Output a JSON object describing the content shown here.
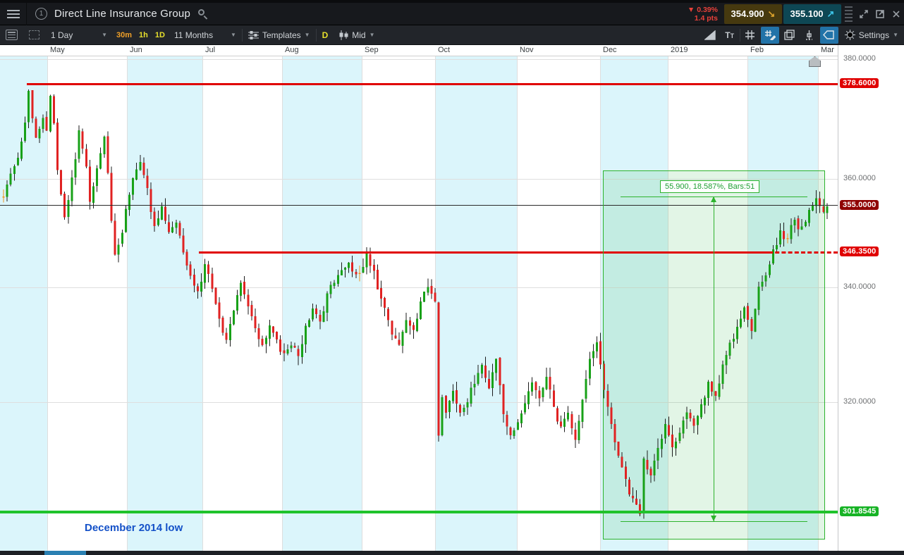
{
  "window": {
    "title": "Direct Line Insurance Group",
    "change_pct": "▼ 0.39%",
    "change_pts": "1.4 pts",
    "sell_price": "354.900",
    "buy_price": "355.100",
    "sell_arrow": "↘",
    "buy_arrow": "↗"
  },
  "toolbar": {
    "period": "1 Day",
    "intervals": [
      "30m",
      "1h",
      "1D"
    ],
    "range": "11 Months",
    "templates_label": "Templates",
    "chart_type_letter": "D",
    "price_mode": "Mid",
    "settings_label": "Settings",
    "accent_active": "#2273a8"
  },
  "chart_data": {
    "type": "candlestick",
    "instrument": "Direct Line Insurance Group",
    "period": "1 Day",
    "range": "11 Months",
    "month_labels": [
      "May",
      "Jun",
      "Jul",
      "Aug",
      "Sep",
      "Oct",
      "Nov",
      "Dec",
      "2019",
      "Feb",
      "Mar"
    ],
    "month_bounds": [
      0,
      67,
      180,
      287,
      400,
      513,
      617,
      733,
      851,
      947,
      1060,
      1160,
      1188
    ],
    "y_ticks": [
      {
        "price": 380,
        "label": "380.0000",
        "y_page": 84
      },
      {
        "price": 360,
        "label": "360.0000"
      },
      {
        "price": 340,
        "label": "340.0000"
      },
      {
        "price": 320,
        "label": "320.0000"
      }
    ],
    "levels": [
      {
        "name": "resistance-378",
        "price": 378.6,
        "label": "378.6000",
        "color": "#e00000",
        "badge_bg": "#e00000",
        "thick": 3,
        "x_start": 38,
        "style": "solid"
      },
      {
        "name": "current-355",
        "price": 355.0,
        "label": "355.0000",
        "color": "#2a2a2a",
        "badge_bg": "#8f0000",
        "thick": 1,
        "x_start": 0,
        "style": "solid"
      },
      {
        "name": "support-346",
        "price": 346.35,
        "label": "346.3500",
        "color": "#e00000",
        "badge_bg": "#e00000",
        "thick": 3,
        "x_start": 282,
        "dash_from": 1090,
        "style": "solid-then-dashed"
      },
      {
        "name": "dec-2014-low",
        "price": 301.8545,
        "label": "301.8545",
        "color": "#1fc32b",
        "badge_bg": "#17b325",
        "thick": 4,
        "x_start": 0,
        "style": "solid"
      }
    ],
    "measurement": {
      "label": "55.900, 18.587%, Bars:51",
      "value_pts": 55.9,
      "value_pct": "18.587%",
      "bars": 51,
      "box": {
        "x1": 855,
        "y1": 242,
        "x2": 1170,
        "y2": 766
      },
      "inner": {
        "x1": 880,
        "x2": 1145,
        "y_top": 279,
        "y_bot": 740,
        "arrow_x": 1012
      },
      "label_box": {
        "x": 936,
        "y": 256
      }
    },
    "annotation": {
      "text": "December 2014 low",
      "x": 120,
      "y": 741
    },
    "scale": {
      "type": "log",
      "p_ref": 378.6,
      "y_ref": 119,
      "k": 2685
    },
    "bars": {
      "count": 230,
      "x0": 5,
      "dx": 5.1,
      "body_w": 3,
      "seed": 1337,
      "close_anchors": [
        [
          0,
          357
        ],
        [
          2,
          361
        ],
        [
          4,
          364
        ],
        [
          6,
          371
        ],
        [
          7,
          377.5
        ],
        [
          8,
          372
        ],
        [
          9,
          368
        ],
        [
          10,
          370
        ],
        [
          11,
          372
        ],
        [
          12,
          369
        ],
        [
          13,
          376.5
        ],
        [
          14,
          371
        ],
        [
          15,
          362
        ],
        [
          16,
          357
        ],
        [
          17,
          353
        ],
        [
          18,
          356
        ],
        [
          19,
          360
        ],
        [
          20,
          364
        ],
        [
          21,
          369
        ],
        [
          22,
          366
        ],
        [
          23,
          362
        ],
        [
          24,
          356
        ],
        [
          25,
          359
        ],
        [
          26,
          362
        ],
        [
          27,
          365
        ],
        [
          28,
          368
        ],
        [
          29,
          361
        ],
        [
          30,
          352
        ],
        [
          31,
          346
        ],
        [
          32,
          348
        ],
        [
          33,
          350
        ],
        [
          34,
          354
        ],
        [
          35,
          357
        ],
        [
          36,
          360
        ],
        [
          37,
          362
        ],
        [
          38,
          363
        ],
        [
          39,
          361
        ],
        [
          40,
          358
        ],
        [
          41,
          354
        ],
        [
          42,
          351
        ],
        [
          43,
          353
        ],
        [
          44,
          355
        ],
        [
          45,
          352
        ],
        [
          46,
          350
        ],
        [
          47,
          351
        ],
        [
          48,
          352
        ],
        [
          49,
          349
        ],
        [
          50,
          346
        ],
        [
          51,
          344
        ],
        [
          52,
          342
        ],
        [
          53,
          340
        ],
        [
          54,
          339
        ],
        [
          55,
          341
        ],
        [
          56,
          344
        ],
        [
          57,
          342
        ],
        [
          58,
          340
        ],
        [
          59,
          337
        ],
        [
          60,
          334
        ],
        [
          61,
          332
        ],
        [
          62,
          331
        ],
        [
          63,
          333
        ],
        [
          64,
          336
        ],
        [
          65,
          339
        ],
        [
          66,
          341
        ],
        [
          67,
          339
        ],
        [
          68,
          337
        ],
        [
          69,
          335
        ],
        [
          70,
          333
        ],
        [
          71,
          331
        ],
        [
          72,
          330
        ],
        [
          73,
          331
        ],
        [
          74,
          333
        ],
        [
          75,
          332
        ],
        [
          76,
          331
        ],
        [
          77,
          329
        ],
        [
          78,
          328
        ],
        [
          79,
          329
        ],
        [
          80,
          330
        ],
        [
          81,
          329
        ],
        [
          82,
          328
        ],
        [
          83,
          330
        ],
        [
          84,
          333
        ],
        [
          85,
          334
        ],
        [
          86,
          336
        ],
        [
          87,
          335
        ],
        [
          88,
          334
        ],
        [
          89,
          336
        ],
        [
          90,
          339
        ],
        [
          92,
          341
        ],
        [
          94,
          343
        ],
        [
          96,
          344
        ],
        [
          98,
          342
        ],
        [
          100,
          344
        ],
        [
          101,
          346
        ],
        [
          102,
          344
        ],
        [
          103,
          343
        ],
        [
          104,
          340
        ],
        [
          105,
          338
        ],
        [
          106,
          336
        ],
        [
          107,
          334
        ],
        [
          108,
          332
        ],
        [
          109,
          331
        ],
        [
          110,
          330
        ],
        [
          111,
          332
        ],
        [
          112,
          334
        ],
        [
          113,
          333
        ],
        [
          114,
          332
        ],
        [
          115,
          334
        ],
        [
          116,
          337
        ],
        [
          117,
          339
        ],
        [
          118,
          340
        ],
        [
          119,
          339
        ],
        [
          120,
          337
        ],
        [
          121,
          314
        ],
        [
          122,
          321
        ],
        [
          123,
          318
        ],
        [
          124,
          320
        ],
        [
          125,
          322
        ],
        [
          126,
          320
        ],
        [
          127,
          318
        ],
        [
          128,
          319
        ],
        [
          129,
          320
        ],
        [
          130,
          322
        ],
        [
          131,
          323
        ],
        [
          132,
          325
        ],
        [
          133,
          326
        ],
        [
          134,
          324
        ],
        [
          135,
          322
        ],
        [
          136,
          325
        ],
        [
          137,
          327
        ],
        [
          138,
          323
        ],
        [
          139,
          318
        ],
        [
          140,
          316
        ],
        [
          141,
          314
        ],
        [
          142,
          315
        ],
        [
          143,
          317
        ],
        [
          144,
          318
        ],
        [
          145,
          320
        ],
        [
          146,
          322
        ],
        [
          147,
          323
        ],
        [
          148,
          322
        ],
        [
          149,
          321
        ],
        [
          150,
          322
        ],
        [
          151,
          324
        ],
        [
          152,
          322
        ],
        [
          153,
          319
        ],
        [
          154,
          317
        ],
        [
          155,
          316
        ],
        [
          156,
          317
        ],
        [
          157,
          318
        ],
        [
          158,
          316
        ],
        [
          159,
          314
        ],
        [
          160,
          317
        ],
        [
          161,
          320
        ],
        [
          162,
          324
        ],
        [
          163,
          327
        ],
        [
          164,
          329
        ],
        [
          165,
          330
        ],
        [
          166,
          326
        ],
        [
          167,
          322
        ],
        [
          168,
          319
        ],
        [
          169,
          316
        ],
        [
          170,
          313
        ],
        [
          171,
          311
        ],
        [
          172,
          309
        ],
        [
          173,
          307
        ],
        [
          174,
          305
        ],
        [
          175,
          304
        ],
        [
          176,
          303.5
        ],
        [
          177,
          301.5
        ],
        [
          178,
          310.5
        ],
        [
          179,
          309
        ],
        [
          180,
          308
        ],
        [
          181,
          310
        ],
        [
          182,
          312
        ],
        [
          183,
          314
        ],
        [
          184,
          316
        ],
        [
          185,
          314
        ],
        [
          186,
          312
        ],
        [
          187,
          313
        ],
        [
          188,
          315
        ],
        [
          189,
          317
        ],
        [
          190,
          318
        ],
        [
          191,
          317
        ],
        [
          192,
          316
        ],
        [
          193,
          318
        ],
        [
          194,
          320
        ],
        [
          195,
          321
        ],
        [
          196,
          323
        ],
        [
          197,
          322
        ],
        [
          198,
          321
        ],
        [
          199,
          323
        ],
        [
          200,
          326
        ],
        [
          201,
          328
        ],
        [
          202,
          330
        ],
        [
          203,
          331
        ],
        [
          204,
          333
        ],
        [
          205,
          334
        ],
        [
          206,
          336
        ],
        [
          207,
          334
        ],
        [
          208,
          332
        ],
        [
          209,
          336
        ],
        [
          210,
          340
        ],
        [
          211,
          341
        ],
        [
          212,
          342
        ],
        [
          213,
          344
        ],
        [
          214,
          347
        ],
        [
          215,
          348
        ],
        [
          216,
          350
        ],
        [
          217,
          349
        ],
        [
          218,
          349
        ],
        [
          219,
          351
        ],
        [
          220,
          352
        ],
        [
          221,
          351
        ],
        [
          222,
          351
        ],
        [
          223,
          352
        ],
        [
          224,
          354
        ],
        [
          225,
          355
        ],
        [
          226,
          356
        ],
        [
          227,
          355
        ],
        [
          228,
          354
        ],
        [
          229,
          355.1
        ]
      ]
    },
    "colors": {
      "up": "#18a118",
      "down": "#e02222",
      "doji": "#f0941e",
      "wick": "#1c1c1c",
      "band": "#dbf5fb",
      "grid": "#dedede",
      "box_fill": "rgba(60,190,90,0.15)",
      "box_border": "#2db32d",
      "measure": "#2db32d",
      "green_line": "#1fc32b",
      "annotation_blue": "#1451c8"
    },
    "scrollbar": {
      "handle_x1": 63,
      "handle_x2": 122
    }
  }
}
